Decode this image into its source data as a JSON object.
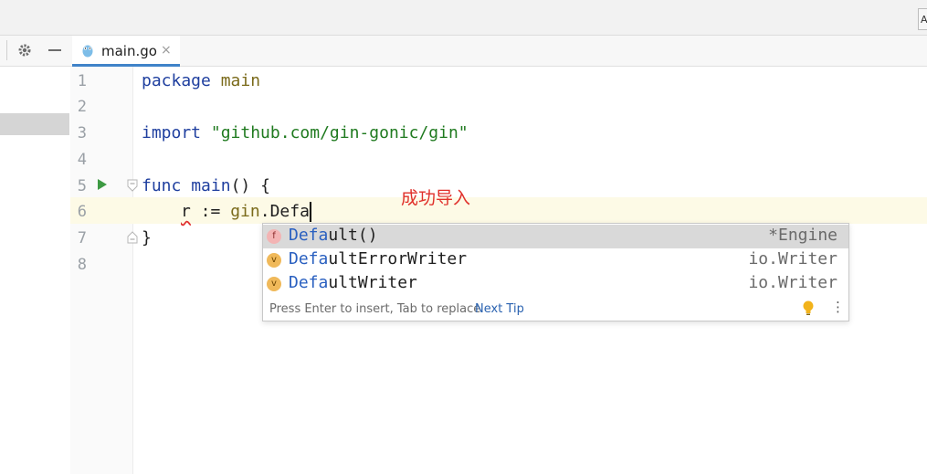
{
  "topbar": {
    "corner_label": "A"
  },
  "editor_tab": {
    "filename": "main.go",
    "close_glyph": "×"
  },
  "toolbar": {
    "settings_icon": "gear-icon",
    "hide_icon": "minus-icon"
  },
  "line_numbers": [
    "1",
    "2",
    "3",
    "4",
    "5",
    "6",
    "7",
    "8"
  ],
  "code": {
    "l1_kw": "package",
    "l1_name": "main",
    "l3_kw": "import",
    "l3_str": "\"github.com/gin-gonic/gin\"",
    "l5_kw": "func",
    "l5_name": "main",
    "l5_rest": "() {",
    "l6_var": "r",
    "l6_op": " := ",
    "l6_pkg": "gin",
    "l6_dot": ".",
    "l6_typed": "Defa",
    "l7": "}"
  },
  "annotation": "成功导入",
  "completion": {
    "items": [
      {
        "kind": "f",
        "match": "Defa",
        "rest": "ult()",
        "type": "*Engine"
      },
      {
        "kind": "v",
        "match": "Defa",
        "rest": "ultErrorWriter",
        "type": "io.Writer"
      },
      {
        "kind": "v",
        "match": "Defa",
        "rest": "ultWriter",
        "type": "io.Writer"
      }
    ],
    "hint": "Press Enter to insert, Tab to replace",
    "next_tip": "Next Tip"
  },
  "colors": {
    "accent": "#4083c9",
    "annotation": "#e0302a",
    "selection": "#d9d9d9"
  }
}
